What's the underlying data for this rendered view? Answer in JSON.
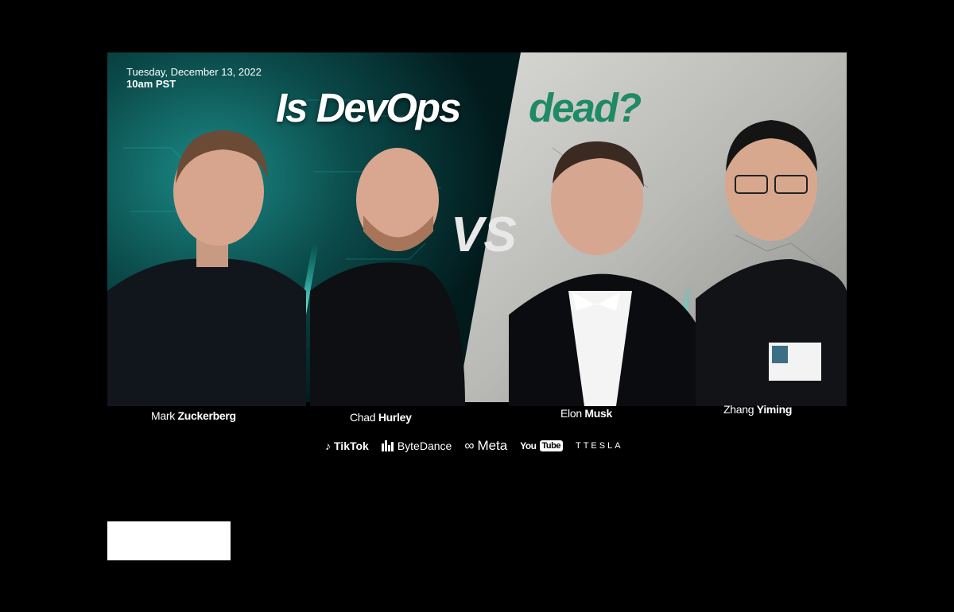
{
  "event": {
    "date": "Tuesday, December 13, 2022",
    "time": "10am PST"
  },
  "title": {
    "left": "Is DevOps",
    "right": "dead?"
  },
  "versus": "VS",
  "speakers": [
    {
      "first": "Mark",
      "last": "Zuckerberg"
    },
    {
      "first": "Chad",
      "last": "Hurley"
    },
    {
      "first": "Elon",
      "last": "Musk"
    },
    {
      "first": "Zhang",
      "last": "Yiming"
    }
  ],
  "logos": {
    "tiktok": "TikTok",
    "bytedance": "ByteDance",
    "meta": "Meta",
    "youtube_you": "You",
    "youtube_tube": "Tube",
    "tesla": "TTESLA"
  },
  "colors": {
    "accent_teal": "#1fd1c0",
    "title_green": "#1e8a66",
    "background": "#000000"
  }
}
